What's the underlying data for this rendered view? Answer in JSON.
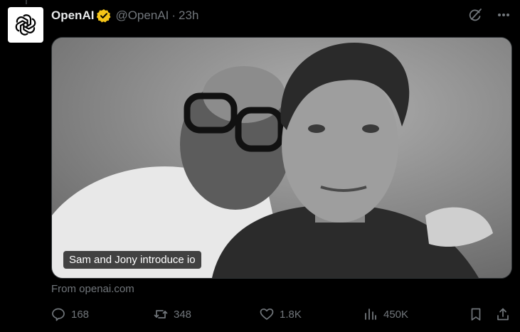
{
  "post": {
    "author_name": "OpenAI",
    "handle": "@OpenAI",
    "separator": "·",
    "time": "23h",
    "verified_color": "#f5c518",
    "avatar_icon": "openai-logo-icon",
    "top_actions": [
      "grok-icon",
      "more-icon"
    ],
    "media": {
      "caption": "Sam and Jony introduce io"
    },
    "link_source": "From openai.com",
    "metrics": {
      "replies": "168",
      "reposts": "348",
      "likes": "1.8K",
      "views": "450K"
    },
    "action_icons": [
      "reply-icon",
      "repost-icon",
      "like-icon",
      "views-icon",
      "bookmark-icon",
      "share-icon"
    ]
  },
  "colors": {
    "background": "#000000",
    "text_primary": "#e7e9ea",
    "text_secondary": "#71767b",
    "border": "#2f3336"
  }
}
